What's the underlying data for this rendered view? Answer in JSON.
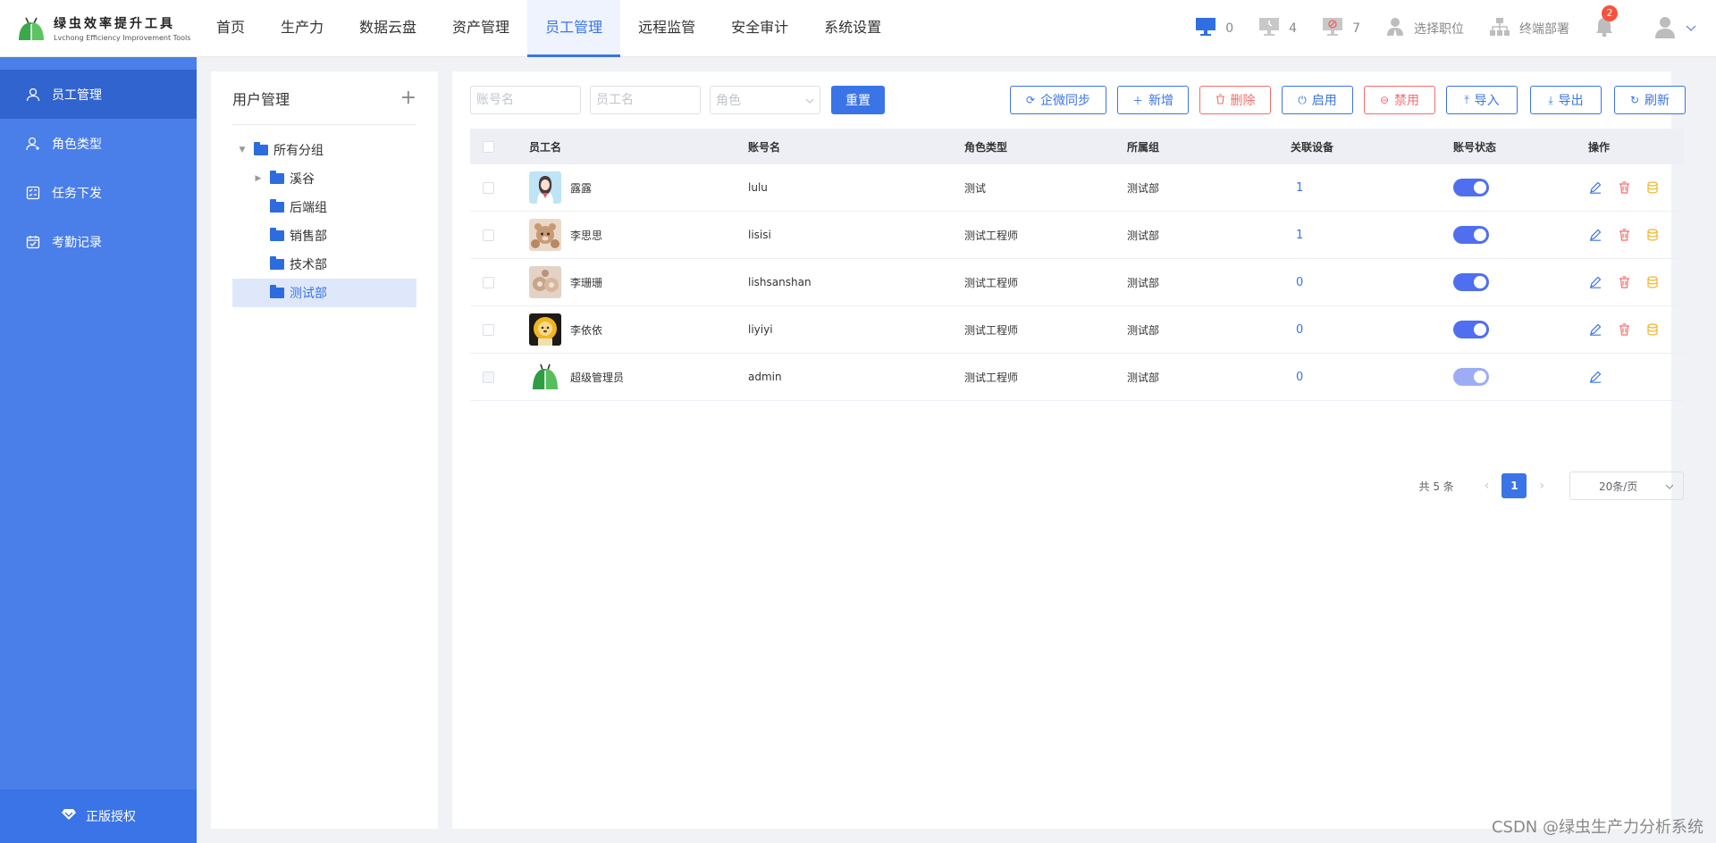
{
  "app": {
    "name_cn": "绿虫效率提升工具",
    "name_en": "Lvchong Efficiency Improvement Tools"
  },
  "topnav": {
    "items": [
      {
        "label": "首页",
        "active": false
      },
      {
        "label": "生产力",
        "active": false
      },
      {
        "label": "数据云盘",
        "active": false
      },
      {
        "label": "资产管理",
        "active": false
      },
      {
        "label": "员工管理",
        "active": true
      },
      {
        "label": "远程监管",
        "active": false
      },
      {
        "label": "安全审计",
        "active": false
      },
      {
        "label": "系统设置",
        "active": false
      }
    ]
  },
  "header_right": {
    "online_count": "0",
    "offline_count": "4",
    "alert_count": "7",
    "select_position": "选择职位",
    "terminal_deploy": "终端部署",
    "notification_badge": "2"
  },
  "sidebar": {
    "items": [
      {
        "label": "员工管理",
        "icon": "user-icon",
        "active": true
      },
      {
        "label": "角色类型",
        "icon": "role-icon",
        "active": false
      },
      {
        "label": "任务下发",
        "icon": "task-icon",
        "active": false
      },
      {
        "label": "考勤记录",
        "icon": "calendar-icon",
        "active": false
      }
    ],
    "license_label": "正版授权"
  },
  "tree": {
    "title": "用户管理",
    "add_symbol": "+",
    "nodes": [
      {
        "label": "所有分组",
        "expanded": true,
        "active": false
      },
      {
        "label": "溪谷",
        "expanded": false,
        "active": false
      },
      {
        "label": "后端组",
        "active": false
      },
      {
        "label": "销售部",
        "active": false
      },
      {
        "label": "技术部",
        "active": false
      },
      {
        "label": "测试部",
        "active": true
      }
    ]
  },
  "filters": {
    "account_placeholder": "账号名",
    "employee_placeholder": "员工名",
    "role_placeholder": "角色",
    "reset_label": "重置"
  },
  "actions": {
    "sync": "企微同步",
    "add": "新增",
    "delete": "删除",
    "enable": "启用",
    "disable": "禁用",
    "import": "导入",
    "export": "导出",
    "refresh": "刷新"
  },
  "table": {
    "columns": [
      "员工名",
      "账号名",
      "角色类型",
      "所属组",
      "关联设备",
      "账号状态",
      "操作"
    ],
    "rows": [
      {
        "name": "露露",
        "account": "lulu",
        "role": "测试",
        "group": "测试部",
        "devices": "1",
        "enabled": true,
        "avatar": "girl-avatar"
      },
      {
        "name": "李思思",
        "account": "lisisi",
        "role": "测试工程师",
        "group": "测试部",
        "devices": "1",
        "enabled": true,
        "avatar": "bear-avatar"
      },
      {
        "name": "李珊珊",
        "account": "lishsanshan",
        "role": "测试工程师",
        "group": "测试部",
        "devices": "0",
        "enabled": true,
        "avatar": "bear-avatar-2"
      },
      {
        "name": "李依依",
        "account": "liyiyi",
        "role": "测试工程师",
        "group": "测试部",
        "devices": "0",
        "enabled": true,
        "avatar": "lion-avatar"
      },
      {
        "name": "超级管理员",
        "account": "admin",
        "role": "测试工程师",
        "group": "测试部",
        "devices": "0",
        "enabled": true,
        "avatar": "logo-avatar"
      }
    ]
  },
  "pagination": {
    "total": "共 5 条",
    "current": "1",
    "page_size": "20条/页"
  },
  "watermark": "CSDN @绿虫生产力分析系统",
  "colors": {
    "primary": "#3a74e6",
    "sidebar": "#4a7ee9",
    "danger": "#f56c6c",
    "switch_on": "#4f6ef0",
    "warning": "#f0b429"
  }
}
